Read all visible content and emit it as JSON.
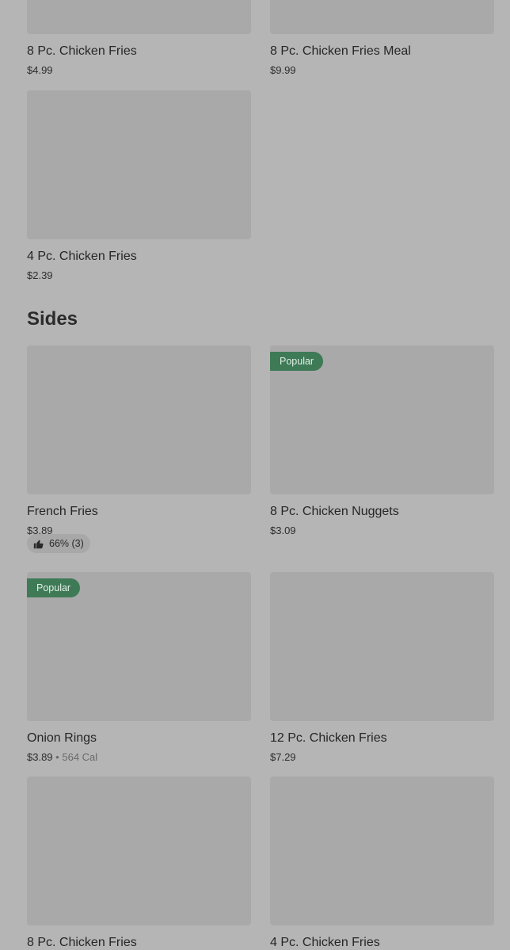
{
  "section_prev_items": [
    {
      "name": "8 Pc. Chicken Fries",
      "price": "$4.99"
    },
    {
      "name": "8 Pc. Chicken Fries Meal",
      "price": "$9.99"
    },
    {
      "name": "4 Pc. Chicken Fries",
      "price": "$2.39"
    }
  ],
  "sides": {
    "title": "Sides",
    "items": [
      {
        "name": "French Fries",
        "price": "$3.89",
        "rating": "66% (3)"
      },
      {
        "name": "8 Pc. Chicken Nuggets",
        "price": "$3.09",
        "badge": "Popular"
      },
      {
        "name": "Onion Rings",
        "price": "$3.89",
        "separator": "•",
        "calories": "564 Cal",
        "badge": "Popular"
      },
      {
        "name": "12 Pc. Chicken Fries",
        "price": "$7.29"
      },
      {
        "name": "8 Pc. Chicken Fries"
      },
      {
        "name": "4 Pc. Chicken Fries"
      }
    ]
  },
  "colors": {
    "badge_bg": "#3f7a57",
    "placeholder": "#a9a9a9",
    "background": "#b5b5b5"
  },
  "icons": {
    "rating": "thumbs-up-icon"
  }
}
